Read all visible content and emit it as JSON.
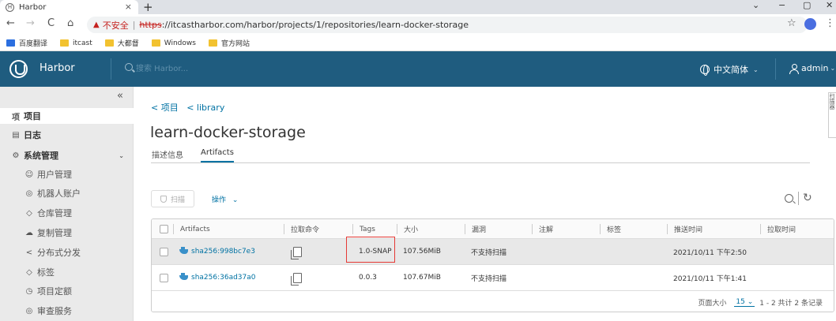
{
  "browser": {
    "tab_title": "Harbor",
    "tab_favicon": "H",
    "new_tab": "+",
    "close": "×",
    "controls": {
      "minimize": "−",
      "maximize": "▢",
      "close": "✕",
      "expand": "⌄"
    },
    "nav": {
      "back": "←",
      "forward": "→",
      "reload": "C",
      "home": "⌂"
    },
    "warning_icon": "▲",
    "insecure_label": "不安全",
    "separator": "|",
    "url_scheme": "https",
    "url_rest": "://itcastharbor.com/harbor/projects/1/repositories/learn-docker-storage",
    "star": "☆",
    "menu": "⋮",
    "bookmarks": [
      {
        "label": "百度翻译",
        "color": "#2b6fe0"
      },
      {
        "label": "itcast",
        "color": "#f2c230"
      },
      {
        "label": "大都督",
        "color": "#f2c230"
      },
      {
        "label": "Windows",
        "color": "#f2c230"
      },
      {
        "label": "官方网站",
        "color": "#f2c230"
      }
    ]
  },
  "header": {
    "brand": "Harbor",
    "search_placeholder": "搜索 Harbor...",
    "language": "中文简体",
    "user": "admin",
    "caret": "⌄"
  },
  "sidebar": {
    "collapse": "«",
    "items": [
      {
        "label": "项目",
        "icon": "项",
        "level": "top",
        "active": true
      },
      {
        "label": "日志",
        "icon": "▤",
        "level": "top"
      },
      {
        "label": "系统管理",
        "icon": "⚙",
        "level": "top",
        "expanded": true
      },
      {
        "label": "用户管理",
        "icon": "☺",
        "level": "sub"
      },
      {
        "label": "机器人账户",
        "icon": "◎",
        "level": "sub"
      },
      {
        "label": "仓库管理",
        "icon": "◇",
        "level": "sub"
      },
      {
        "label": "复制管理",
        "icon": "☁",
        "level": "sub"
      },
      {
        "label": "分布式分发",
        "icon": "<",
        "level": "sub"
      },
      {
        "label": "标签",
        "icon": "◇",
        "level": "sub"
      },
      {
        "label": "项目定额",
        "icon": "◷",
        "level": "sub"
      },
      {
        "label": "审查服务",
        "icon": "◎",
        "level": "sub"
      }
    ]
  },
  "main": {
    "breadcrumb": [
      "< 项目",
      "< library"
    ],
    "title": "learn-docker-storage",
    "tabs": [
      "描述信息",
      "Artifacts"
    ],
    "active_tab": 1,
    "scan_label": "扫描",
    "ops_label": "操作",
    "ops_caret": "⌄",
    "refresh": "↻"
  },
  "grid": {
    "columns": [
      "Artifacts",
      "拉取命令",
      "Tags",
      "大小",
      "漏洞",
      "注解",
      "标签",
      "推送时间",
      "拉取时间"
    ],
    "rows": [
      {
        "digest": "sha256:998bc7e3",
        "tag": "1.0-SNAP",
        "size": "107.56MiB",
        "vuln": "不支持扫描",
        "push_time": "2021/10/11 下午2:50",
        "selected": true
      },
      {
        "digest": "sha256:36ad37a0",
        "tag": "0.0.3",
        "size": "107.67MiB",
        "vuln": "不支持扫描",
        "push_time": "2021/10/11 下午1:41",
        "selected": false
      }
    ],
    "footer": {
      "page_size_label": "页面大小",
      "page_size": "15",
      "caret": "⌄",
      "summary": "1 - 2 共计 2 条记录"
    }
  },
  "right_panel": "扫描器"
}
